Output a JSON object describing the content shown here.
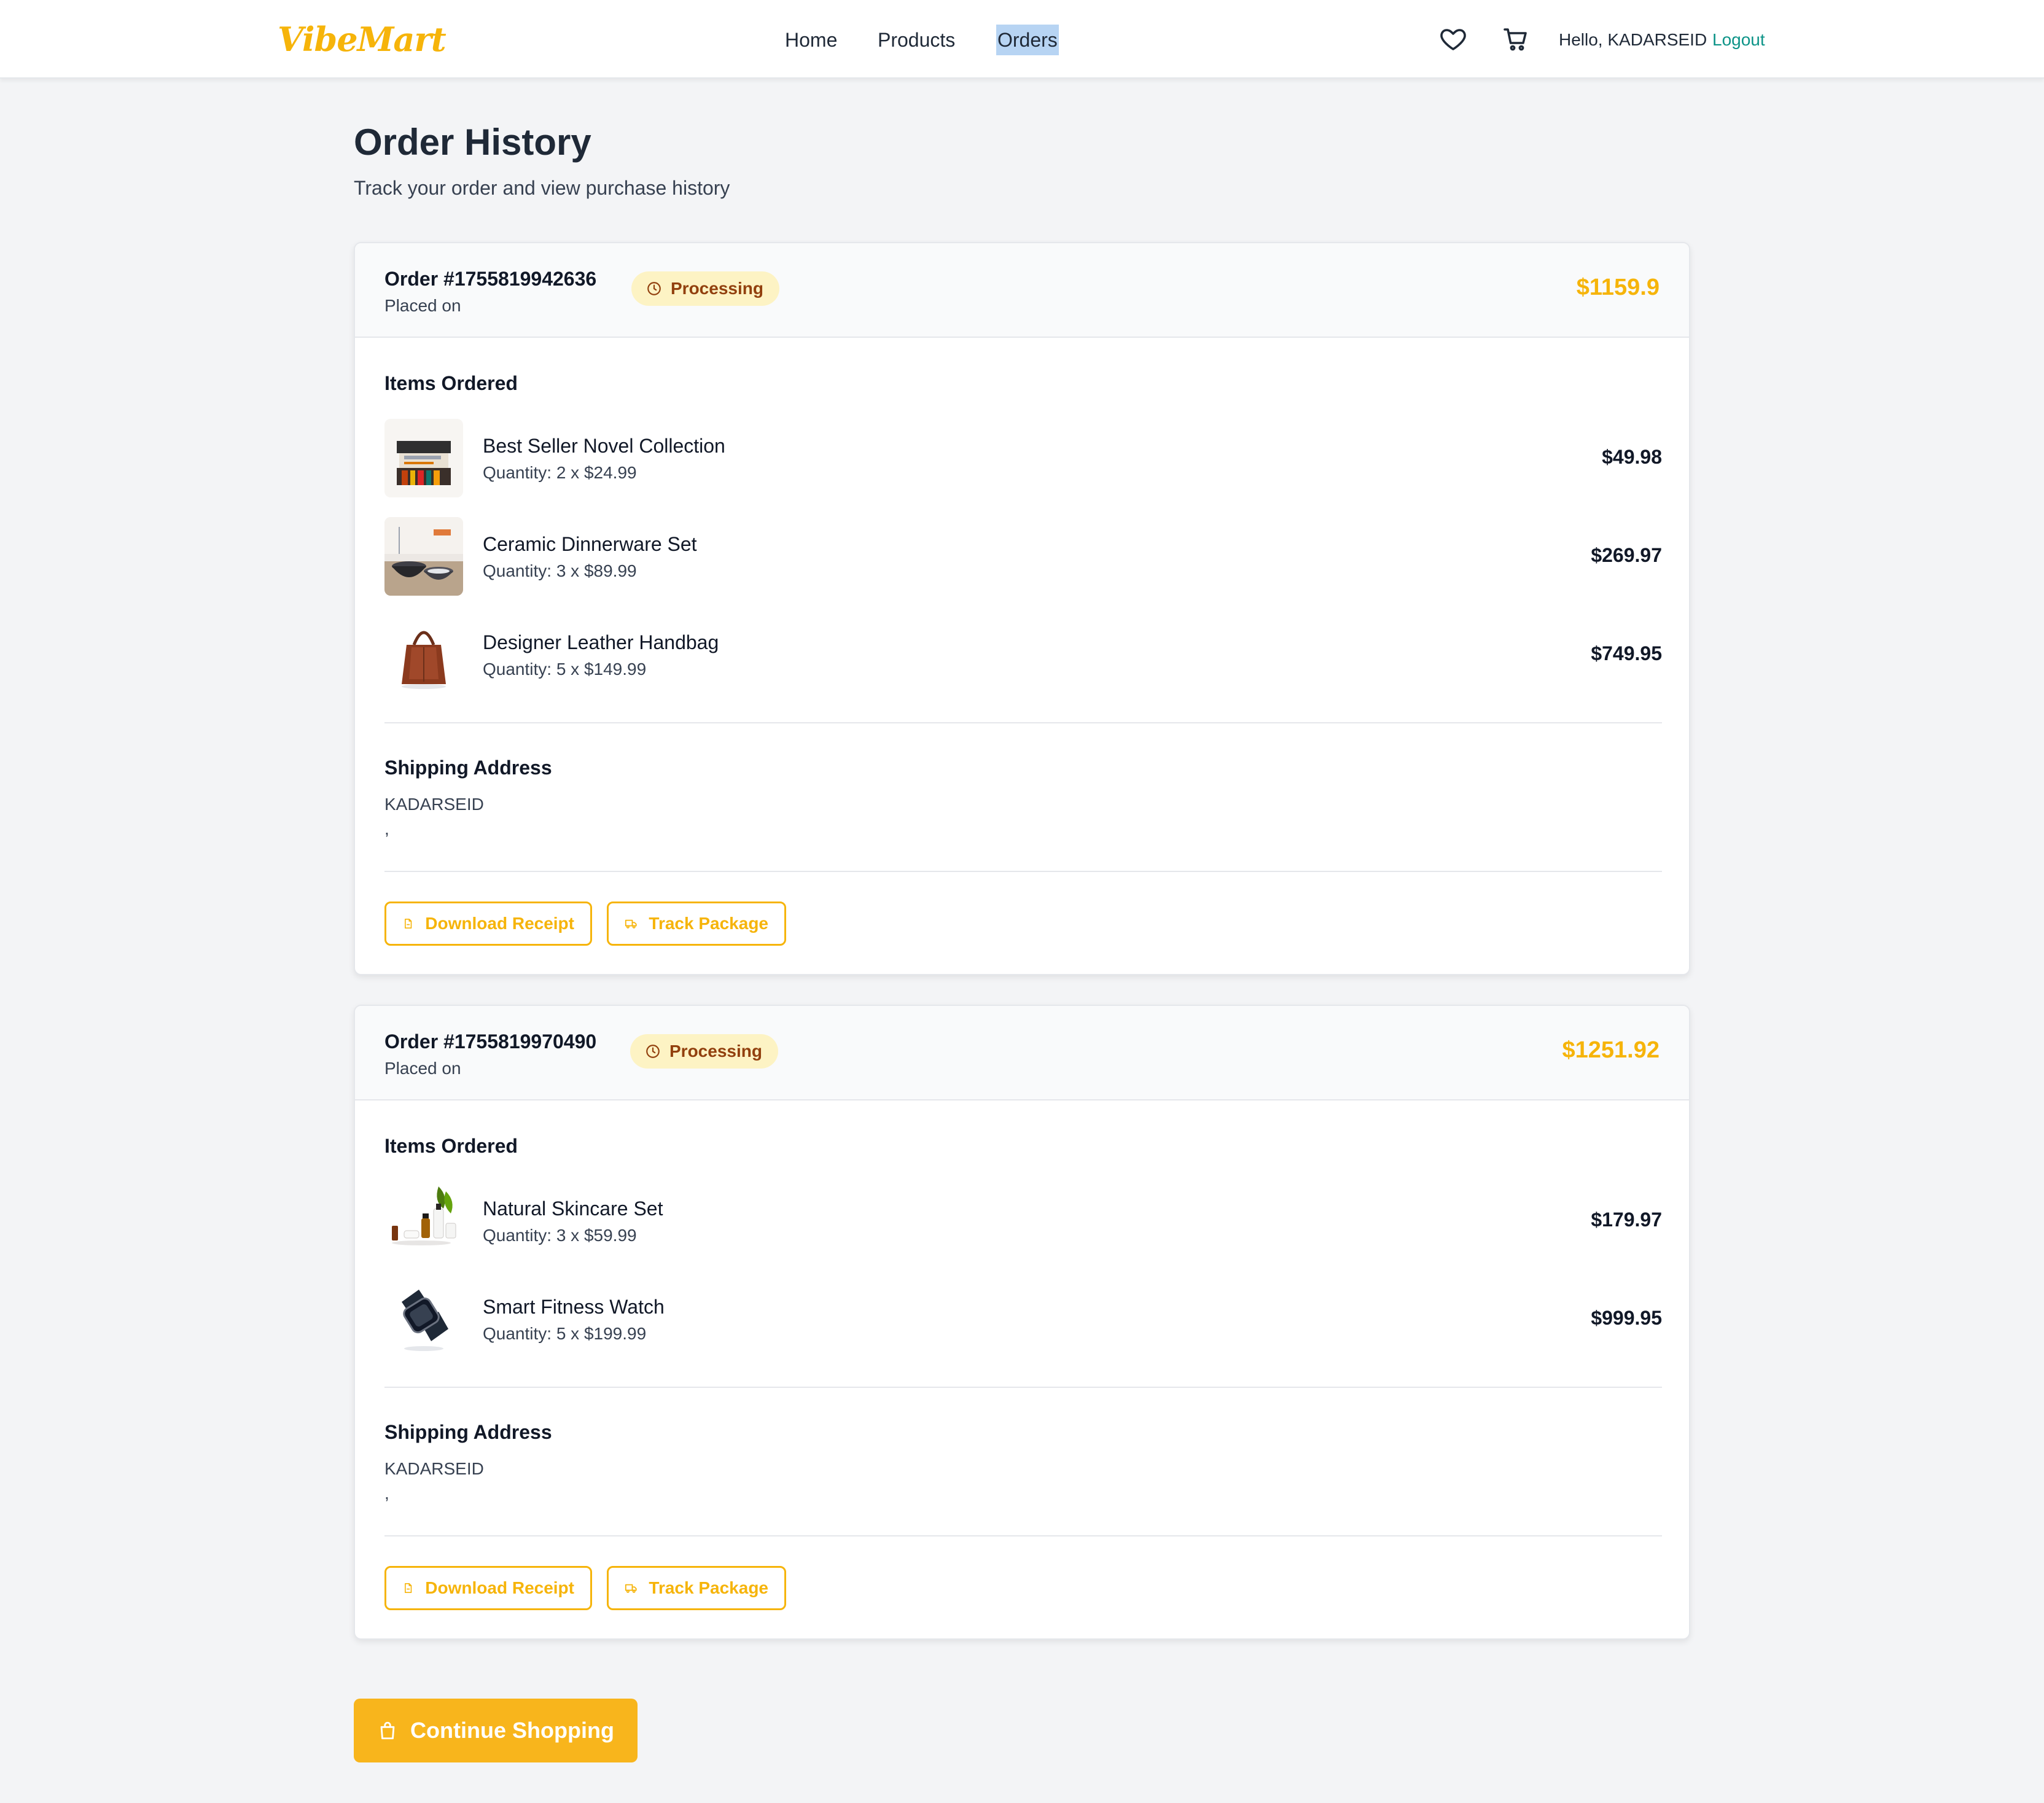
{
  "header": {
    "logo": "VibeMart",
    "nav": [
      "Home",
      "Products",
      "Orders"
    ],
    "active_nav": "Orders",
    "greeting": "Hello, KADARSEID",
    "logout": "Logout",
    "icons": [
      "heart-icon",
      "cart-icon"
    ]
  },
  "page": {
    "title": "Order History",
    "subtitle": "Track your order and view purchase history"
  },
  "labels": {
    "items_ordered": "Items Ordered",
    "shipping_address": "Shipping Address",
    "placed_on": "Placed on",
    "download_receipt": "Download Receipt",
    "track_package": "Track Package",
    "continue_shopping": "Continue Shopping"
  },
  "orders": [
    {
      "number": "Order #1755819942636",
      "status": "Processing",
      "total": "$1159.9",
      "items": [
        {
          "name": "Best Seller Novel Collection",
          "qty": "Quantity: 2 x $24.99",
          "price": "$49.98",
          "thumb": "books"
        },
        {
          "name": "Ceramic Dinnerware Set",
          "qty": "Quantity: 3 x $89.99",
          "price": "$269.97",
          "thumb": "dinnerware"
        },
        {
          "name": "Designer Leather Handbag",
          "qty": "Quantity: 5 x $149.99",
          "price": "$749.95",
          "thumb": "handbag"
        }
      ],
      "address": {
        "name": "KADARSEID",
        "line": ","
      }
    },
    {
      "number": "Order #1755819970490",
      "status": "Processing",
      "total": "$1251.92",
      "items": [
        {
          "name": "Natural Skincare Set",
          "qty": "Quantity: 3 x $59.99",
          "price": "$179.97",
          "thumb": "skincare"
        },
        {
          "name": "Smart Fitness Watch",
          "qty": "Quantity: 5 x $199.99",
          "price": "$999.95",
          "thumb": "watch"
        }
      ],
      "address": {
        "name": "KADARSEID",
        "line": ","
      }
    }
  ],
  "colors": {
    "accent": "#f6b40a",
    "badge_bg": "#fdf3c4",
    "badge_text": "#92400e",
    "logout": "#0d9488"
  }
}
